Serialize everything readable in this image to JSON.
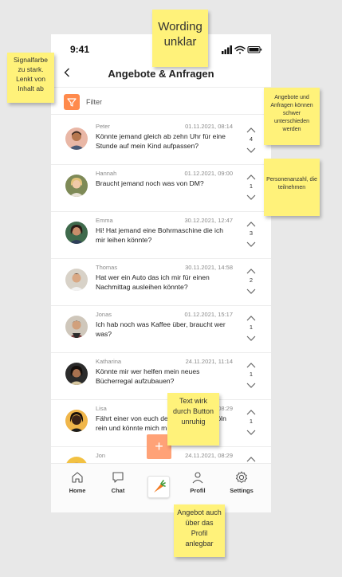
{
  "status": {
    "time": "9:41"
  },
  "header": {
    "back_icon": "chevron-left-icon",
    "title": "Angebote & Anfragen"
  },
  "filter": {
    "label": "Filter",
    "icon": "filter-icon",
    "accent": "#ff8a4c"
  },
  "posts": [
    {
      "name": "Peter",
      "date": "01.11.2021, 08:14",
      "text": "Könnte jemand gleich ab zehn Uhr für eine Stunde auf mein Kind aufpassen?",
      "votes": "4"
    },
    {
      "name": "Hannah",
      "date": "01.12.2021, 09:00",
      "text": "Braucht jemand noch was von DM?",
      "votes": "1"
    },
    {
      "name": "Emma",
      "date": "30.12.2021, 12:47",
      "text": "Hi! Hat jemand eine Bohrmaschine die ich mir leihen könnte?",
      "votes": "3"
    },
    {
      "name": "Thomas",
      "date": "30.11.2021, 14:58",
      "text": "Hat wer ein Auto das ich mir für einen Nachmittag ausleihen könnte?",
      "votes": "2"
    },
    {
      "name": "Jonas",
      "date": "01.12.2021, 15:17",
      "text": "Ich hab noch was Kaffee über, braucht wer was?",
      "votes": "1"
    },
    {
      "name": "Katharina",
      "date": "24.11.2021, 11:14",
      "text": "Könnte mir wer helfen mein neues Bücherregal aufzubauen?",
      "votes": "1"
    },
    {
      "name": "Lisa",
      "date": "24.11.2021, 08:29",
      "text": "Fährt einer von euch demnächst nach Köln rein und könnte mich mitnehmen?",
      "votes": "1"
    },
    {
      "name": "Jon",
      "date": "24.11.2021, 08:29",
      "text": "",
      "votes": ""
    }
  ],
  "fab": {
    "symbol": "+",
    "icon": "plus-icon"
  },
  "tabbar": {
    "items": [
      {
        "label": "Home",
        "icon": "home-icon"
      },
      {
        "label": "Chat",
        "icon": "chat-icon"
      },
      {
        "label": "",
        "icon": "carrot-logo-icon"
      },
      {
        "label": "Profil",
        "icon": "profile-icon"
      },
      {
        "label": "Settings",
        "icon": "gear-icon"
      }
    ]
  },
  "notes": {
    "wording": "Wording unklar",
    "signal": "Signalfarbe zu stark. Lenkt von Inhalt ab",
    "distinguish": "Angebote und Anfragen können schwer unterschieden werden",
    "persons": "Personenanzahl, die teilnehmen",
    "button_text": "Text wirk durch Button unruhig",
    "offer_profile": "Angebot auch über das Profil anlegbar"
  },
  "colors": {
    "accent": "#ff8a4c",
    "fab": "#ffa277",
    "sticky": "#fff27a"
  }
}
